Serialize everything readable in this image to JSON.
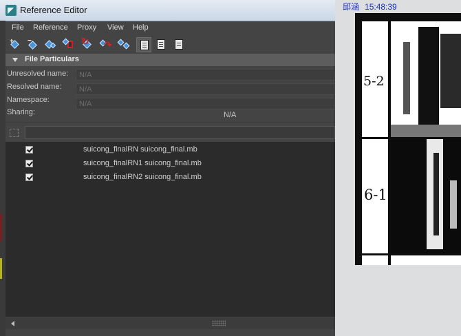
{
  "window": {
    "title": "Reference Editor"
  },
  "menu": {
    "items": [
      "File",
      "Reference",
      "Proxy",
      "View",
      "Help"
    ]
  },
  "section": {
    "title": "File Particulars"
  },
  "fields": {
    "unresolved_label": "Unresolved name:",
    "unresolved_value": "N/A",
    "resolved_label": "Resolved name:",
    "resolved_value": "N/A",
    "namespace_label": "Namespace:",
    "namespace_value": "N/A",
    "sharing_label": "Sharing:",
    "sharing_value": "N/A"
  },
  "references": [
    {
      "checked": true,
      "text": "suicong_finalRN suicong_final.mb"
    },
    {
      "checked": true,
      "text": "suicong_finalRN1 suicong_final.mb"
    },
    {
      "checked": true,
      "text": "suicong_finalRN2 suicong_final.mb"
    }
  ],
  "clock": {
    "name": "邱涵",
    "time": "15:48:39"
  },
  "storyboard": {
    "labels": [
      "5-2",
      "6-1"
    ]
  },
  "colors": {
    "accent": "#4b93d9",
    "alert": "#c92727",
    "clock_text": "#1a2cc4"
  }
}
